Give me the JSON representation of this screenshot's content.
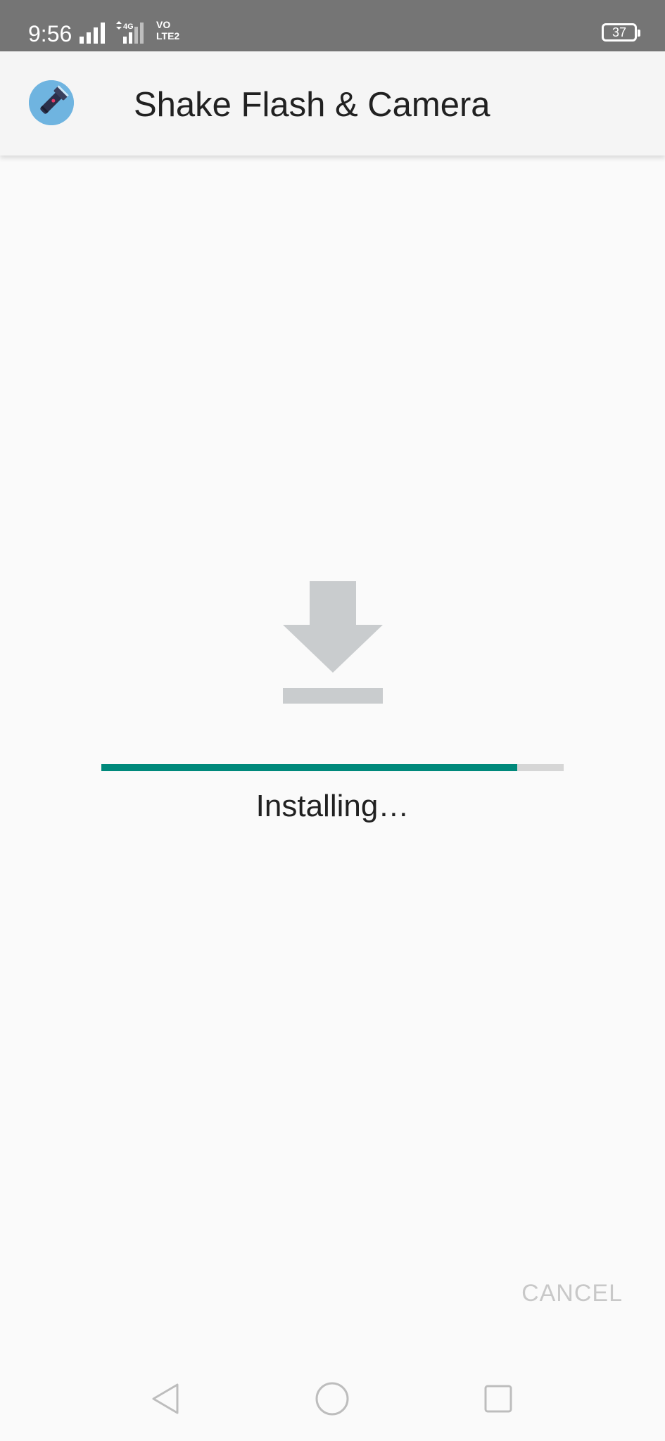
{
  "status_bar": {
    "time": "9:56",
    "network_type": "4G",
    "volte_label_top": "VO",
    "volte_label_bottom": "LTE2",
    "battery_level": "37"
  },
  "app_bar": {
    "icon": "flashlight-icon",
    "title": "Shake Flash & Camera"
  },
  "install": {
    "icon": "download-icon",
    "progress_fraction": 0.9,
    "status": "Installing…",
    "cancel_label": "CANCEL"
  },
  "nav_bar": {
    "back_icon": "back-triangle-icon",
    "home_icon": "home-circle-icon",
    "recent_icon": "recents-square-icon"
  },
  "colors": {
    "status_bar_bg": "#757575",
    "app_bar_bg": "#f5f5f5",
    "background": "#fafafa",
    "progress_fill": "#00897b",
    "progress_track": "#d6d6d6",
    "download_icon": "#c9ccce",
    "cancel_text": "#c8c8c8"
  }
}
